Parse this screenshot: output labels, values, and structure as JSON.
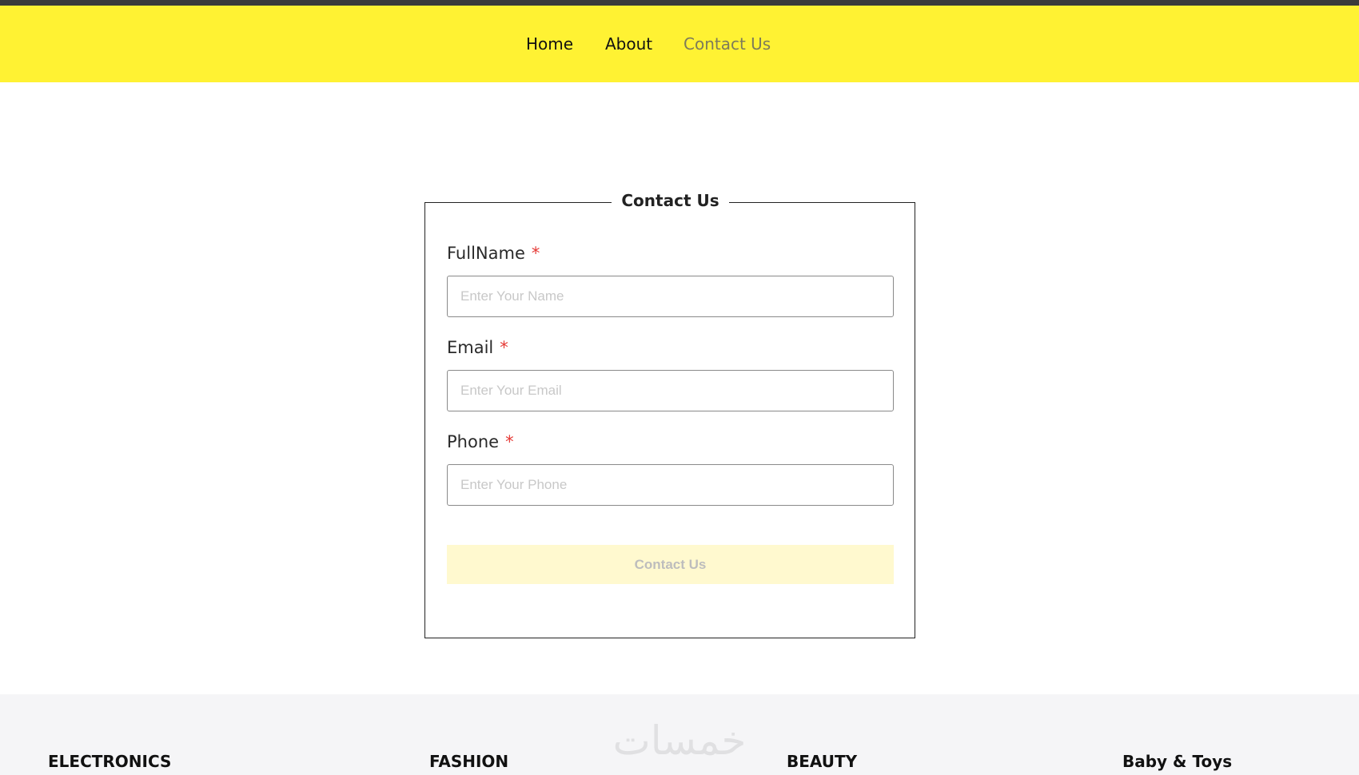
{
  "nav": {
    "items": [
      {
        "label": "Home"
      },
      {
        "label": "About"
      },
      {
        "label": "Contact Us",
        "active": true
      }
    ]
  },
  "form": {
    "legend": "Contact Us",
    "fields": [
      {
        "label": "FullName",
        "required": "*",
        "placeholder": "Enter Your Name"
      },
      {
        "label": "Email",
        "required": "*",
        "placeholder": "Enter Your Email"
      },
      {
        "label": "Phone",
        "required": "*",
        "placeholder": "Enter Your Phone"
      }
    ],
    "submit_label": "Contact Us"
  },
  "footer": {
    "watermark": "خمسات",
    "columns": [
      {
        "title": "ELECTRONICS"
      },
      {
        "title": "FASHION"
      },
      {
        "title": "BEAUTY"
      },
      {
        "title": "Baby & Toys"
      }
    ]
  },
  "colors": {
    "top_bar": "#3b3b3b",
    "header_bg": "#fff233",
    "nav_active": "#7d7b5a",
    "required_mark": "#e53935",
    "button_bg": "#fff9cf",
    "footer_bg": "#f5f5f7"
  }
}
